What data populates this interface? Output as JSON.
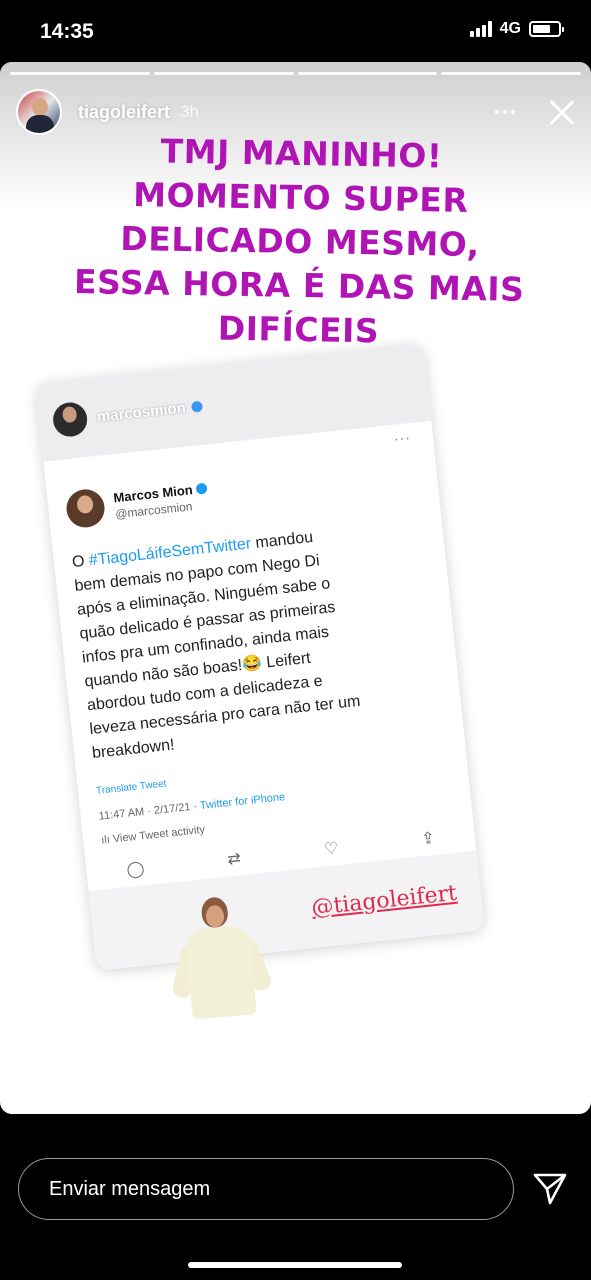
{
  "status_bar": {
    "time": "14:35",
    "network": "4G"
  },
  "story": {
    "username": "tiagoleifert",
    "time_ago": "3h",
    "caption_lines": [
      "TMJ MANINHO!",
      "MOMENTO SUPER",
      "DELICADO MESMO,",
      "ESSA HORA É DAS MAIS",
      "DIFÍCEIS"
    ],
    "caption_color": "#b014b5",
    "embedded_post": {
      "ig_username": "marcosmion",
      "tweet": {
        "author_name": "Marcos Mion",
        "author_handle": "@marcosmion",
        "body": {
          "prefix": "O ",
          "hashtag": "#TiagoLáifeSemTwitter",
          "line1_rest": " mandou",
          "line2": "bem demais no papo com Nego Di",
          "line3": "após a eliminação. Ninguém sabe o",
          "line4": "quão delicado é passar as primeiras",
          "line5": "infos pra um confinado, ainda mais",
          "line6": "quando não são boas!😂 Leifert",
          "line7": "abordou tudo com a delicadeza e",
          "line8": "leveza necessária pro cara não ter um",
          "line9": "breakdown!"
        },
        "translate": "Translate Tweet",
        "meta": "11:47 AM · 2/17/21 · ",
        "source": "Twitter for iPhone",
        "activity": "View Tweet activity"
      },
      "mention": "@tiagoleifert"
    }
  },
  "reply": {
    "placeholder": "Enviar mensagem"
  }
}
